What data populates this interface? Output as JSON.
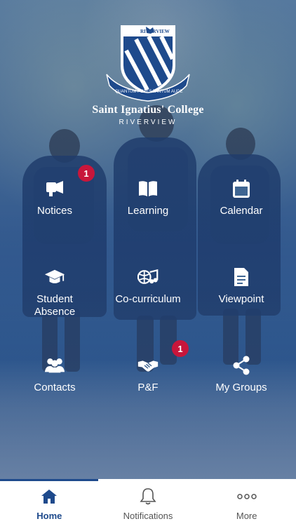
{
  "header": {
    "college_name": "Saint Ignatius' College",
    "college_sub": "RIVERVIEW",
    "crest": {
      "top_text": "RIVERVIEW",
      "motto_left": "QUANTUM POTES",
      "motto_right": "TANTUM AUDE"
    }
  },
  "tiles": [
    {
      "label": "Notices",
      "icon": "megaphone-icon",
      "badge": "1"
    },
    {
      "label": "Learning",
      "icon": "book-icon",
      "badge": ""
    },
    {
      "label": "Calendar",
      "icon": "calendar-icon",
      "badge": ""
    },
    {
      "label": "Student\nAbsence",
      "icon": "graduation-cap-icon",
      "badge": ""
    },
    {
      "label": "Co-curriculum",
      "icon": "sports-music-icon",
      "badge": ""
    },
    {
      "label": "Viewpoint",
      "icon": "document-icon",
      "badge": ""
    },
    {
      "label": "Contacts",
      "icon": "people-icon",
      "badge": ""
    },
    {
      "label": "P&F",
      "icon": "handshake-icon",
      "badge": "1"
    },
    {
      "label": "My Groups",
      "icon": "share-icon",
      "badge": ""
    }
  ],
  "nav": {
    "items": [
      {
        "label": "Home",
        "icon": "home-icon",
        "active": true
      },
      {
        "label": "Notifications",
        "icon": "bell-icon",
        "active": false
      },
      {
        "label": "More",
        "icon": "more-icon",
        "active": false
      }
    ]
  },
  "colors": {
    "accent": "#1e4a8c",
    "badge": "#c8163b",
    "crest_blue": "#1e4a8c"
  }
}
